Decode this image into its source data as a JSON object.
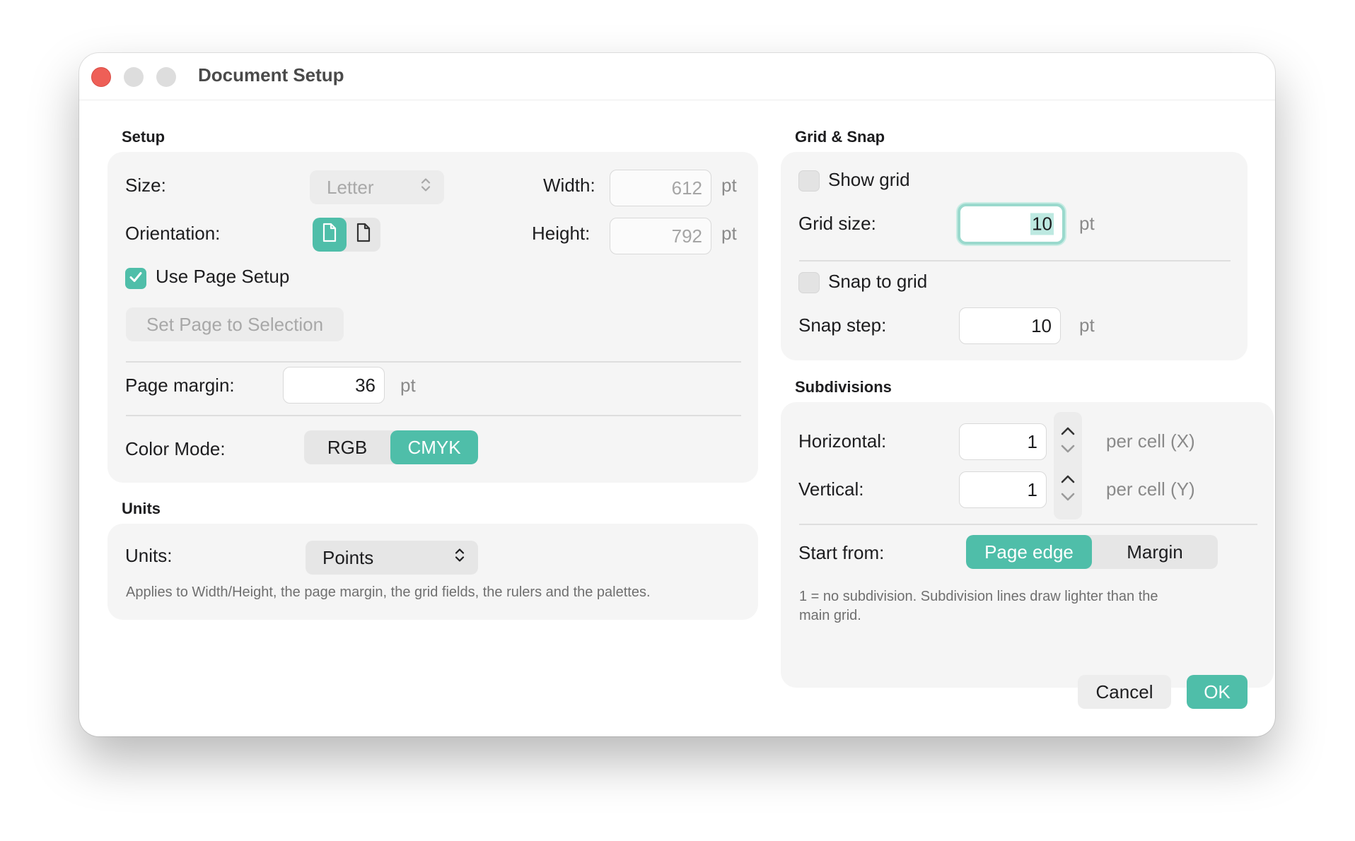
{
  "window": {
    "title": "Document Setup"
  },
  "setup": {
    "section_title": "Setup",
    "size_label": "Size:",
    "size_value": "Letter",
    "width_label": "Width:",
    "width_value": "612",
    "width_unit": "pt",
    "orientation_label": "Orientation:",
    "orientation_options": [
      "portrait-icon",
      "landscape-icon"
    ],
    "orientation_selected": "portrait",
    "height_label": "Height:",
    "height_value": "792",
    "height_unit": "pt",
    "use_page_setup_label": "Use Page Setup",
    "use_page_setup_checked": true,
    "set_page_button": "Set Page to Selection",
    "page_margin_label": "Page margin:",
    "page_margin_value": "36",
    "page_margin_unit": "pt",
    "color_mode_label": "Color Mode:",
    "color_mode_options": [
      "RGB",
      "CMYK"
    ],
    "color_mode_selected": "CMYK"
  },
  "units": {
    "section_title": "Units",
    "units_label": "Units:",
    "units_value": "Points",
    "help_text": "Applies to Width/Height, the page margin, the grid fields, the rulers and the palettes."
  },
  "grid_snap": {
    "section_title": "Grid & Snap",
    "show_grid_label": "Show grid",
    "show_grid_checked": false,
    "grid_size_label": "Grid size:",
    "grid_size_value": "10",
    "grid_size_unit": "pt",
    "snap_to_grid_label": "Snap to grid",
    "snap_to_grid_checked": false,
    "snap_step_label": "Snap step:",
    "snap_step_value": "10",
    "snap_step_unit": "pt"
  },
  "subdivisions": {
    "section_title": "Subdivisions",
    "horizontal_label": "Horizontal:",
    "horizontal_value": "1",
    "horizontal_unit": "per cell (X)",
    "vertical_label": "Vertical:",
    "vertical_value": "1",
    "vertical_unit": "per cell (Y)",
    "start_from_label": "Start from:",
    "start_from_options": [
      "Page edge",
      "Margin"
    ],
    "start_from_selected": "Page edge",
    "help_text_line1": "1 = no subdivision. Subdivision lines draw lighter than the",
    "help_text_line2": "main grid."
  },
  "footer": {
    "cancel_label": "Cancel",
    "ok_label": "OK"
  },
  "colors": {
    "accent": "#4fbea9",
    "close": "#ee5f57"
  }
}
